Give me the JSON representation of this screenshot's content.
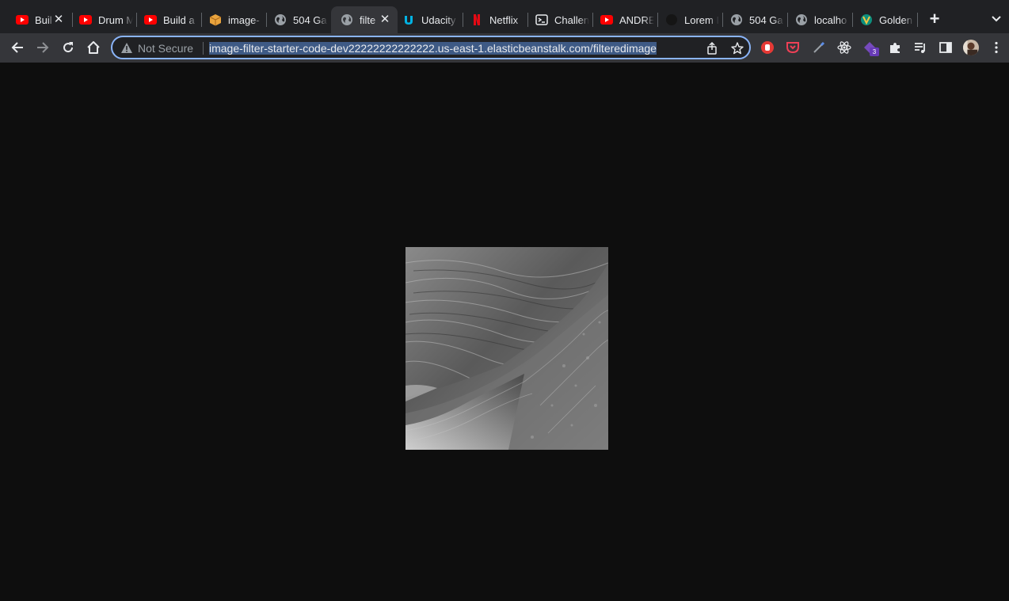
{
  "tabs": [
    {
      "title": "Buil",
      "icon": "youtube-icon",
      "closable": true
    },
    {
      "title": "Drum M",
      "icon": "youtube-icon"
    },
    {
      "title": "Build a",
      "icon": "youtube-icon"
    },
    {
      "title": "image-",
      "icon": "package-icon"
    },
    {
      "title": "504 Ga",
      "icon": "globe-icon"
    },
    {
      "title": "filte",
      "icon": "globe-icon",
      "active": true,
      "closable": true
    },
    {
      "title": "Udacity",
      "icon": "udacity-icon"
    },
    {
      "title": "Netflix",
      "icon": "netflix-icon"
    },
    {
      "title": "Challen",
      "icon": "terminal-icon"
    },
    {
      "title": "ANDRE",
      "icon": "youtube-icon"
    },
    {
      "title": "Lorem I",
      "icon": "dark-circle-icon"
    },
    {
      "title": "504 Ga",
      "icon": "globe-icon"
    },
    {
      "title": "localho",
      "icon": "globe-icon"
    },
    {
      "title": "Golden",
      "icon": "golden-icon"
    }
  ],
  "toolbar": {
    "security_label": "Not Secure",
    "url": "image-filter-starter-code-dev22222222222222.us-east-1.elasticbeanstalk.com/filteredimage",
    "extension_badge": "3"
  },
  "colors": {
    "accent": "#8ab4f8",
    "tabstrip_bg": "#202124",
    "toolbar_bg": "#35363a",
    "page_bg": "#0e0e0e",
    "selection": "#3e5a85"
  },
  "page": {
    "image_alt": "filtered grayscale image of a wave"
  }
}
